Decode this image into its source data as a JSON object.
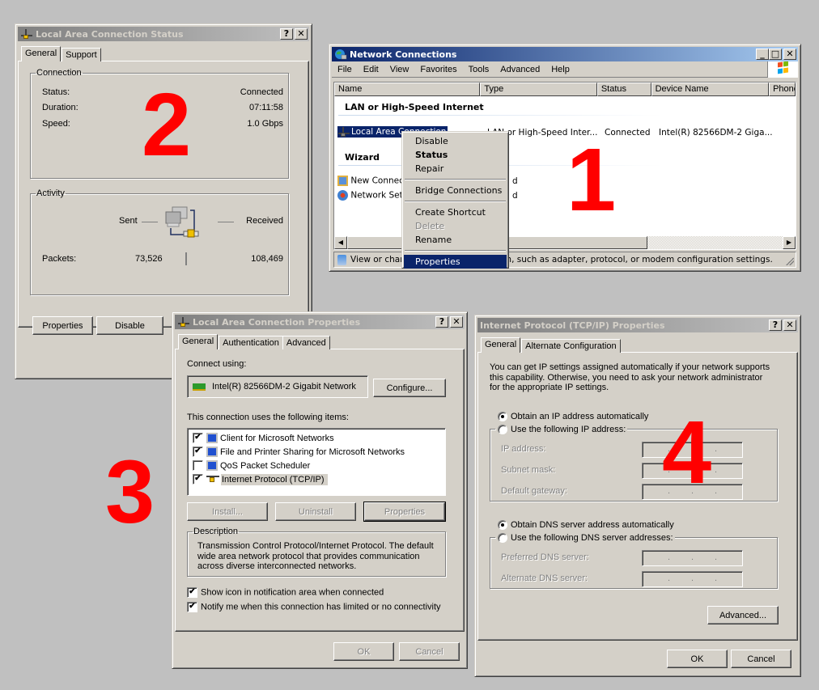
{
  "annotations": {
    "n1": "1",
    "n2": "2",
    "n3": "3",
    "n4": "4"
  },
  "status_window": {
    "title": "Local Area Connection Status",
    "help_btn": "?",
    "close_btn": "✕",
    "tabs": [
      "General",
      "Support"
    ],
    "connection": {
      "legend": "Connection",
      "rows": [
        {
          "label": "Status:",
          "value": "Connected"
        },
        {
          "label": "Duration:",
          "value": "07:11:58"
        },
        {
          "label": "Speed:",
          "value": "1.0 Gbps"
        }
      ]
    },
    "activity": {
      "legend": "Activity",
      "sent_label": "Sent",
      "received_label": "Received",
      "packets_label": "Packets:",
      "packets_sent": "73,526",
      "packets_received": "108,469"
    },
    "buttons": {
      "properties": "Properties",
      "disable": "Disable"
    }
  },
  "network_window": {
    "title": "Network Connections",
    "window_buttons": {
      "minimize": "_",
      "maximize": "□",
      "close": "✕"
    },
    "menu": [
      "File",
      "Edit",
      "View",
      "Favorites",
      "Tools",
      "Advanced",
      "Help"
    ],
    "columns": [
      "Name",
      "Type",
      "Status",
      "Device Name",
      "Phone"
    ],
    "groups": [
      {
        "header": "LAN or High-Speed Internet",
        "items": [
          {
            "name": "Local Area Connection",
            "type": "LAN or High-Speed Inter...",
            "status": "Connected",
            "device": "Intel(R) 82566DM-2 Giga..."
          }
        ]
      },
      {
        "header": "Wizard",
        "items": [
          {
            "name": "New Connec",
            "type": "d"
          },
          {
            "name": "Network Set",
            "type": "d"
          }
        ]
      }
    ],
    "context_menu": [
      {
        "label": "Disable",
        "style": "normal"
      },
      {
        "label": "Status",
        "style": "bold"
      },
      {
        "label": "Repair",
        "style": "normal"
      },
      {
        "sep": true
      },
      {
        "label": "Bridge Connections",
        "style": "normal"
      },
      {
        "sep": true
      },
      {
        "label": "Create Shortcut",
        "style": "normal"
      },
      {
        "label": "Delete",
        "style": "disabled"
      },
      {
        "label": "Rename",
        "style": "normal"
      },
      {
        "sep": true
      },
      {
        "label": "Properties",
        "style": "highlighted"
      }
    ],
    "status_bar": {
      "left": "View or chan",
      "right": "on, such as adapter, protocol, or modem configuration settings."
    }
  },
  "properties_window": {
    "title": "Local Area Connection Properties",
    "help_btn": "?",
    "close_btn": "✕",
    "tabs": [
      "General",
      "Authentication",
      "Advanced"
    ],
    "connect_using_label": "Connect using:",
    "adapter": "Intel(R) 82566DM-2 Gigabit Network",
    "configure_btn": "Configure...",
    "items_label": "This connection uses the following items:",
    "items": [
      {
        "label": "Client for Microsoft Networks",
        "checked": true,
        "icon": "client-icon"
      },
      {
        "label": "File and Printer Sharing for Microsoft Networks",
        "checked": true,
        "icon": "file-share-icon"
      },
      {
        "label": "QoS Packet Scheduler",
        "checked": false,
        "icon": "qos-icon"
      },
      {
        "label": "Internet Protocol (TCP/IP)",
        "checked": true,
        "icon": "protocol-icon",
        "selected": true
      }
    ],
    "buttons": {
      "install": "Install...",
      "uninstall": "Uninstall",
      "properties": "Properties"
    },
    "description_legend": "Description",
    "description": "Transmission Control Protocol/Internet Protocol. The default wide area network protocol that provides communication across diverse interconnected networks.",
    "show_icon": {
      "label": "Show icon in notification area when connected",
      "checked": true
    },
    "notify": {
      "label": "Notify me when this connection has limited or no connectivity",
      "checked": true
    },
    "ok": "OK",
    "cancel": "Cancel"
  },
  "tcpip_window": {
    "title": "Internet Protocol (TCP/IP) Properties",
    "help_btn": "?",
    "close_btn": "✕",
    "tabs": [
      "General",
      "Alternate Configuration"
    ],
    "intro": "You can get IP settings assigned automatically if your network supports this capability. Otherwise, you need to ask your network administrator for the appropriate IP settings.",
    "ip_auto": {
      "label": "Obtain an IP address automatically",
      "selected": true
    },
    "ip_manual": {
      "label": "Use the following IP address:",
      "selected": false
    },
    "ip_fields": [
      {
        "label": "IP address:",
        "value": ". . ."
      },
      {
        "label": "Subnet mask:",
        "value": ". . ."
      },
      {
        "label": "Default gateway:",
        "value": ". . ."
      }
    ],
    "dns_auto": {
      "label": "Obtain DNS server address automatically",
      "selected": true
    },
    "dns_manual": {
      "label": "Use the following DNS server addresses:",
      "selected": false
    },
    "dns_fields": [
      {
        "label": "Preferred DNS server:",
        "value": ". . ."
      },
      {
        "label": "Alternate DNS server:",
        "value": ". . ."
      }
    ],
    "advanced_btn": "Advanced...",
    "ok": "OK",
    "cancel": "Cancel"
  }
}
